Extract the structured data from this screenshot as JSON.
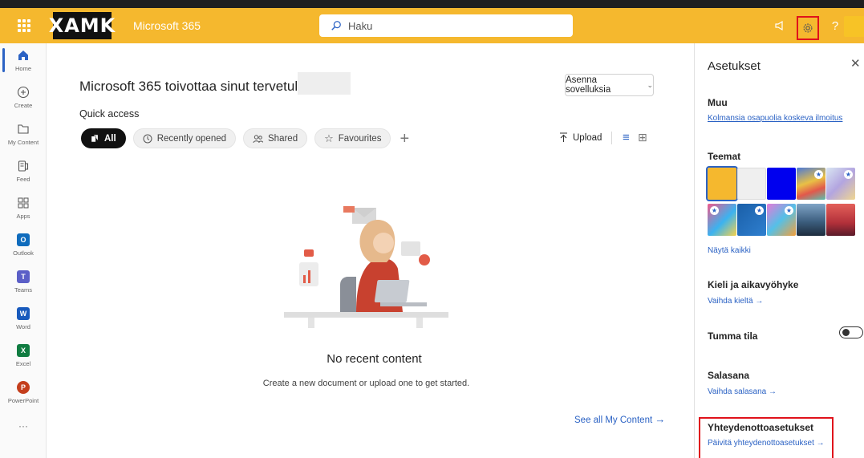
{
  "topbar": {
    "logo": "XAMK",
    "app_name": "Microsoft 365",
    "search_placeholder": "Haku",
    "help": "?"
  },
  "rail": {
    "items": [
      {
        "label": "Home",
        "icon": "home-icon"
      },
      {
        "label": "Create",
        "icon": "create-icon"
      },
      {
        "label": "My Content",
        "icon": "folder-icon"
      },
      {
        "label": "Feed",
        "icon": "feed-icon"
      },
      {
        "label": "Apps",
        "icon": "apps-icon"
      },
      {
        "label": "Outlook",
        "icon": "outlook-icon"
      },
      {
        "label": "Teams",
        "icon": "teams-icon"
      },
      {
        "label": "Word",
        "icon": "word-icon"
      },
      {
        "label": "Excel",
        "icon": "excel-icon"
      },
      {
        "label": "PowerPoint",
        "icon": "powerpoint-icon"
      }
    ],
    "more": "···"
  },
  "main": {
    "welcome": "Microsoft 365 toivottaa sinut tervetulleeksi,",
    "install": "Asenna sovelluksia",
    "quick_access": "Quick access",
    "pills": [
      "All",
      "Recently opened",
      "Shared",
      "Favourites"
    ],
    "upload": "Upload",
    "empty_title": "No recent content",
    "empty_hint": "Create a new document or upload one to get started.",
    "see_all": "See all My Content"
  },
  "settings": {
    "title": "Asetukset",
    "muu": "Muu",
    "muu_link": "Kolmansia osapuolia koskeva ilmoitus",
    "teemat": "Teemat",
    "show_all": "Näytä kaikki",
    "lang_title": "Kieli ja aikavyöhyke",
    "lang_link": "Vaihda kieltä",
    "dark_mode": "Tumma tila",
    "password_title": "Salasana",
    "password_link": "Vaihda salasana",
    "contact_title": "Yhteydenottoasetukset",
    "contact_link": "Päivitä yhteydenottoasetukset"
  },
  "colors": {
    "brand": "#f5b82e",
    "link": "#2b62c4",
    "highlight": "#e0121b"
  }
}
